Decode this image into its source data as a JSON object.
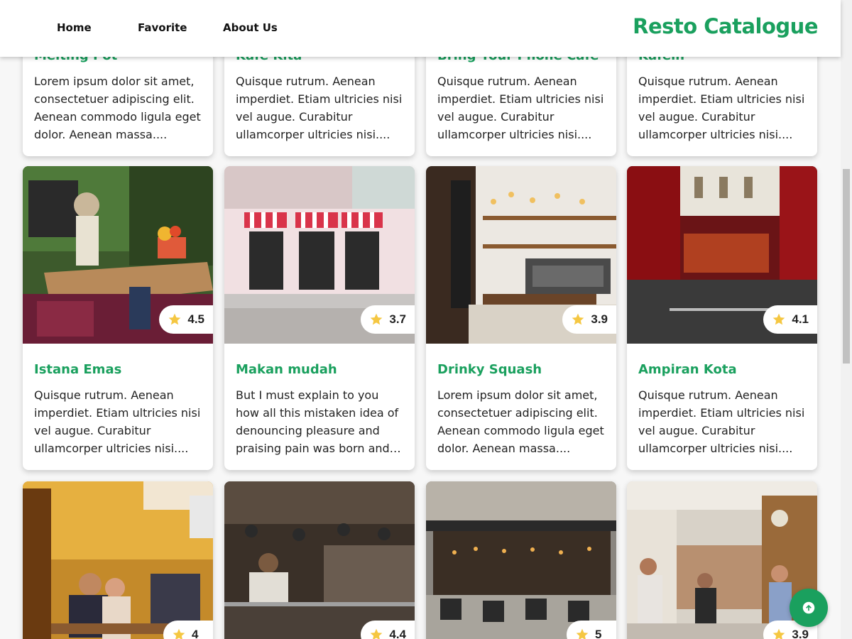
{
  "nav": {
    "links": [
      "Home",
      "Favorite",
      "About Us"
    ],
    "brand": "Resto Catalogue"
  },
  "top_row": [
    {
      "name": "Melting Pot",
      "desc": "Lorem ipsum dolor sit amet, consectetuer adipiscing elit. Aenean commodo ligula eget dolor. Aenean massa...."
    },
    {
      "name": "Kafe Kita",
      "desc": "Quisque rutrum. Aenean imperdiet. Etiam ultricies nisi vel augue. Curabitur ullamcorper ultricies nisi...."
    },
    {
      "name": "Bring Your Phone Cafe",
      "desc": "Quisque rutrum. Aenean imperdiet. Etiam ultricies nisi vel augue. Curabitur ullamcorper ultricies nisi...."
    },
    {
      "name": "Kafein",
      "desc": "Quisque rutrum. Aenean imperdiet. Etiam ultricies nisi vel augue. Curabitur ullamcorper ultricies nisi...."
    }
  ],
  "middle_row": [
    {
      "name": "Istana Emas",
      "rating": "4.5",
      "desc": "Quisque rutrum. Aenean imperdiet. Etiam ultricies nisi vel augue. Curabitur ullamcorper ultricies nisi...."
    },
    {
      "name": "Makan mudah",
      "rating": "3.7",
      "desc": "But I must explain to you how all this mistaken idea of denouncing pleasure and praising pain was born and ..."
    },
    {
      "name": "Drinky Squash",
      "rating": "3.9",
      "desc": "Lorem ipsum dolor sit amet, consectetuer adipiscing elit. Aenean commodo ligula eget dolor. Aenean massa...."
    },
    {
      "name": "Ampiran Kota",
      "rating": "4.1",
      "desc": "Quisque rutrum. Aenean imperdiet. Etiam ultricies nisi vel augue. Curabitur ullamcorper ultricies nisi...."
    }
  ],
  "bottom_row": [
    {
      "rating": "4"
    },
    {
      "rating": "4.4"
    },
    {
      "rating": "5"
    },
    {
      "rating": "3.9"
    }
  ],
  "colors": {
    "accent": "#1aa05e",
    "star": "#f5c742"
  },
  "icons": {
    "rating": "star-icon",
    "fab": "arrow-up-icon"
  }
}
